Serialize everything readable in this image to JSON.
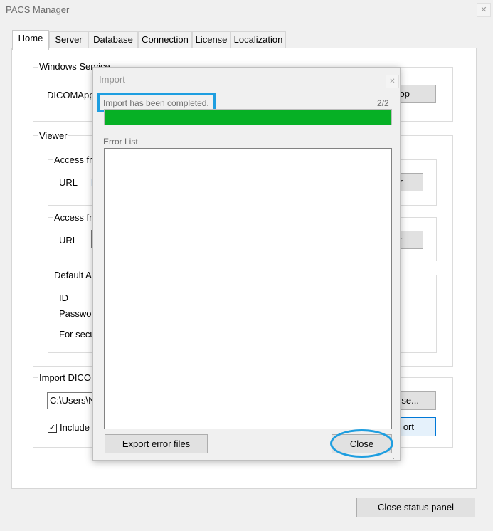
{
  "window": {
    "title": "PACS Manager",
    "close_glyph": "✕"
  },
  "tabs": [
    {
      "label": "Home",
      "active": true
    },
    {
      "label": "Server"
    },
    {
      "label": "Database"
    },
    {
      "label": "Connection"
    },
    {
      "label": "License"
    },
    {
      "label": "Localization"
    }
  ],
  "home": {
    "windows_service": {
      "title": "Windows Service",
      "label": "DICOMApp",
      "button_visible_text": "op"
    },
    "viewer": {
      "title": "Viewer",
      "access1": {
        "title": "Access fro",
        "url_label": "URL",
        "link_fragment": "h",
        "button_visible_text": "r"
      },
      "access2": {
        "title": "Access fro",
        "url_label": "URL",
        "button_visible_text": "r"
      },
      "default_account": {
        "title": "Default A",
        "id_label": "ID",
        "password_label": "Passwor",
        "security_note": "For secu"
      }
    },
    "import_dicom": {
      "title": "Import DICOM",
      "path_value": "C:\\Users\\N",
      "browse_visible_text": "wse...",
      "include_label": "Include s",
      "include_checked": true,
      "check_glyph": "✓",
      "import_visible_text": "ort"
    }
  },
  "footer": {
    "close_status_panel": "Close status panel"
  },
  "modal": {
    "title": "Import",
    "close_glyph": "✕",
    "status_text": "Import has been completed.",
    "counter": "2/2",
    "progress": 1.0,
    "progress_color": "#06b025",
    "error_list_label": "Error List",
    "export_button": "Export error files",
    "close_button": "Close"
  },
  "annotation_color": "#1e9ee0"
}
